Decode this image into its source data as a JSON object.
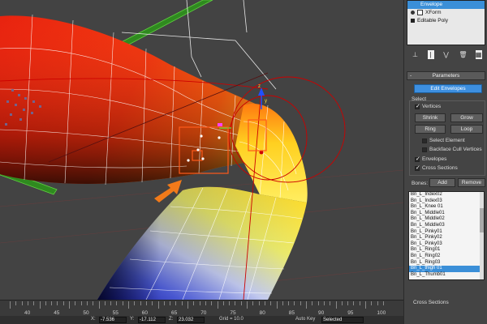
{
  "modifier_stack": {
    "items": [
      {
        "label": "Envelope",
        "selected": true,
        "indent": true
      },
      {
        "label": "XForm",
        "selected": false,
        "indent": false
      },
      {
        "label": "Editable Poly",
        "selected": false,
        "indent": false
      }
    ]
  },
  "toolbar": {
    "icons": [
      "pin-icon",
      "show-end-result-icon",
      "make-unique-icon",
      "remove-modifier-icon",
      "configure-sets-icon"
    ]
  },
  "parameters": {
    "rollout_title": "Parameters",
    "collapse_symbol": "-",
    "edit_envelopes_label": "Edit Envelopes",
    "select_group_label": "Select",
    "vertices_label": "Vertices",
    "shrink_label": "Shrink",
    "grow_label": "Grow",
    "ring_label": "Ring",
    "loop_label": "Loop",
    "select_element_label": "Select Element",
    "backface_label": "Backface Cull Vertices",
    "envelopes_label": "Envelopes",
    "cross_sections_label": "Cross Sections",
    "bones_label": "Bones:",
    "add_label": "Add",
    "remove_label": "Remove",
    "cross_sections_footer": "Cross Sections"
  },
  "bones": [
    "Bn_L_Index02",
    "Bn_L_Index03",
    "Bn_L_Knee 01",
    "Bn_L_Middle01",
    "Bn_L_Middle02",
    "Bn_L_Middle03",
    "Bn_L_Pinky01",
    "Bn_L_Pinky02",
    "Bn_L_Pinky03",
    "Bn_L_Ring01",
    "Bn_L_Ring02",
    "Bn_L_Ring03",
    "Bn_L_thigh 01",
    "Bn_L_Thumb01"
  ],
  "selected_bone": "Bn_L_thigh 01",
  "timeline": {
    "ticks": [
      "40",
      "45",
      "50",
      "55",
      "60",
      "65",
      "70",
      "75",
      "80",
      "85",
      "90",
      "95",
      "100"
    ]
  },
  "status": {
    "x_label": "X:",
    "x_value": "-7.536",
    "y_label": "Y:",
    "y_value": "-17.112",
    "z_label": "Z:",
    "z_value": "23.032",
    "grid_label": "Grid = 10.0",
    "autokey_label": "Auto Key",
    "autokey_value": "Selected"
  },
  "colors": {
    "viewport_bg": "#434343",
    "selection_blue": "#3b8fd8",
    "arrow_orange": "#f27a1a",
    "envelope_red": "#cc0000"
  },
  "viewport": {
    "axis_z": "z",
    "axis_y": "y"
  }
}
